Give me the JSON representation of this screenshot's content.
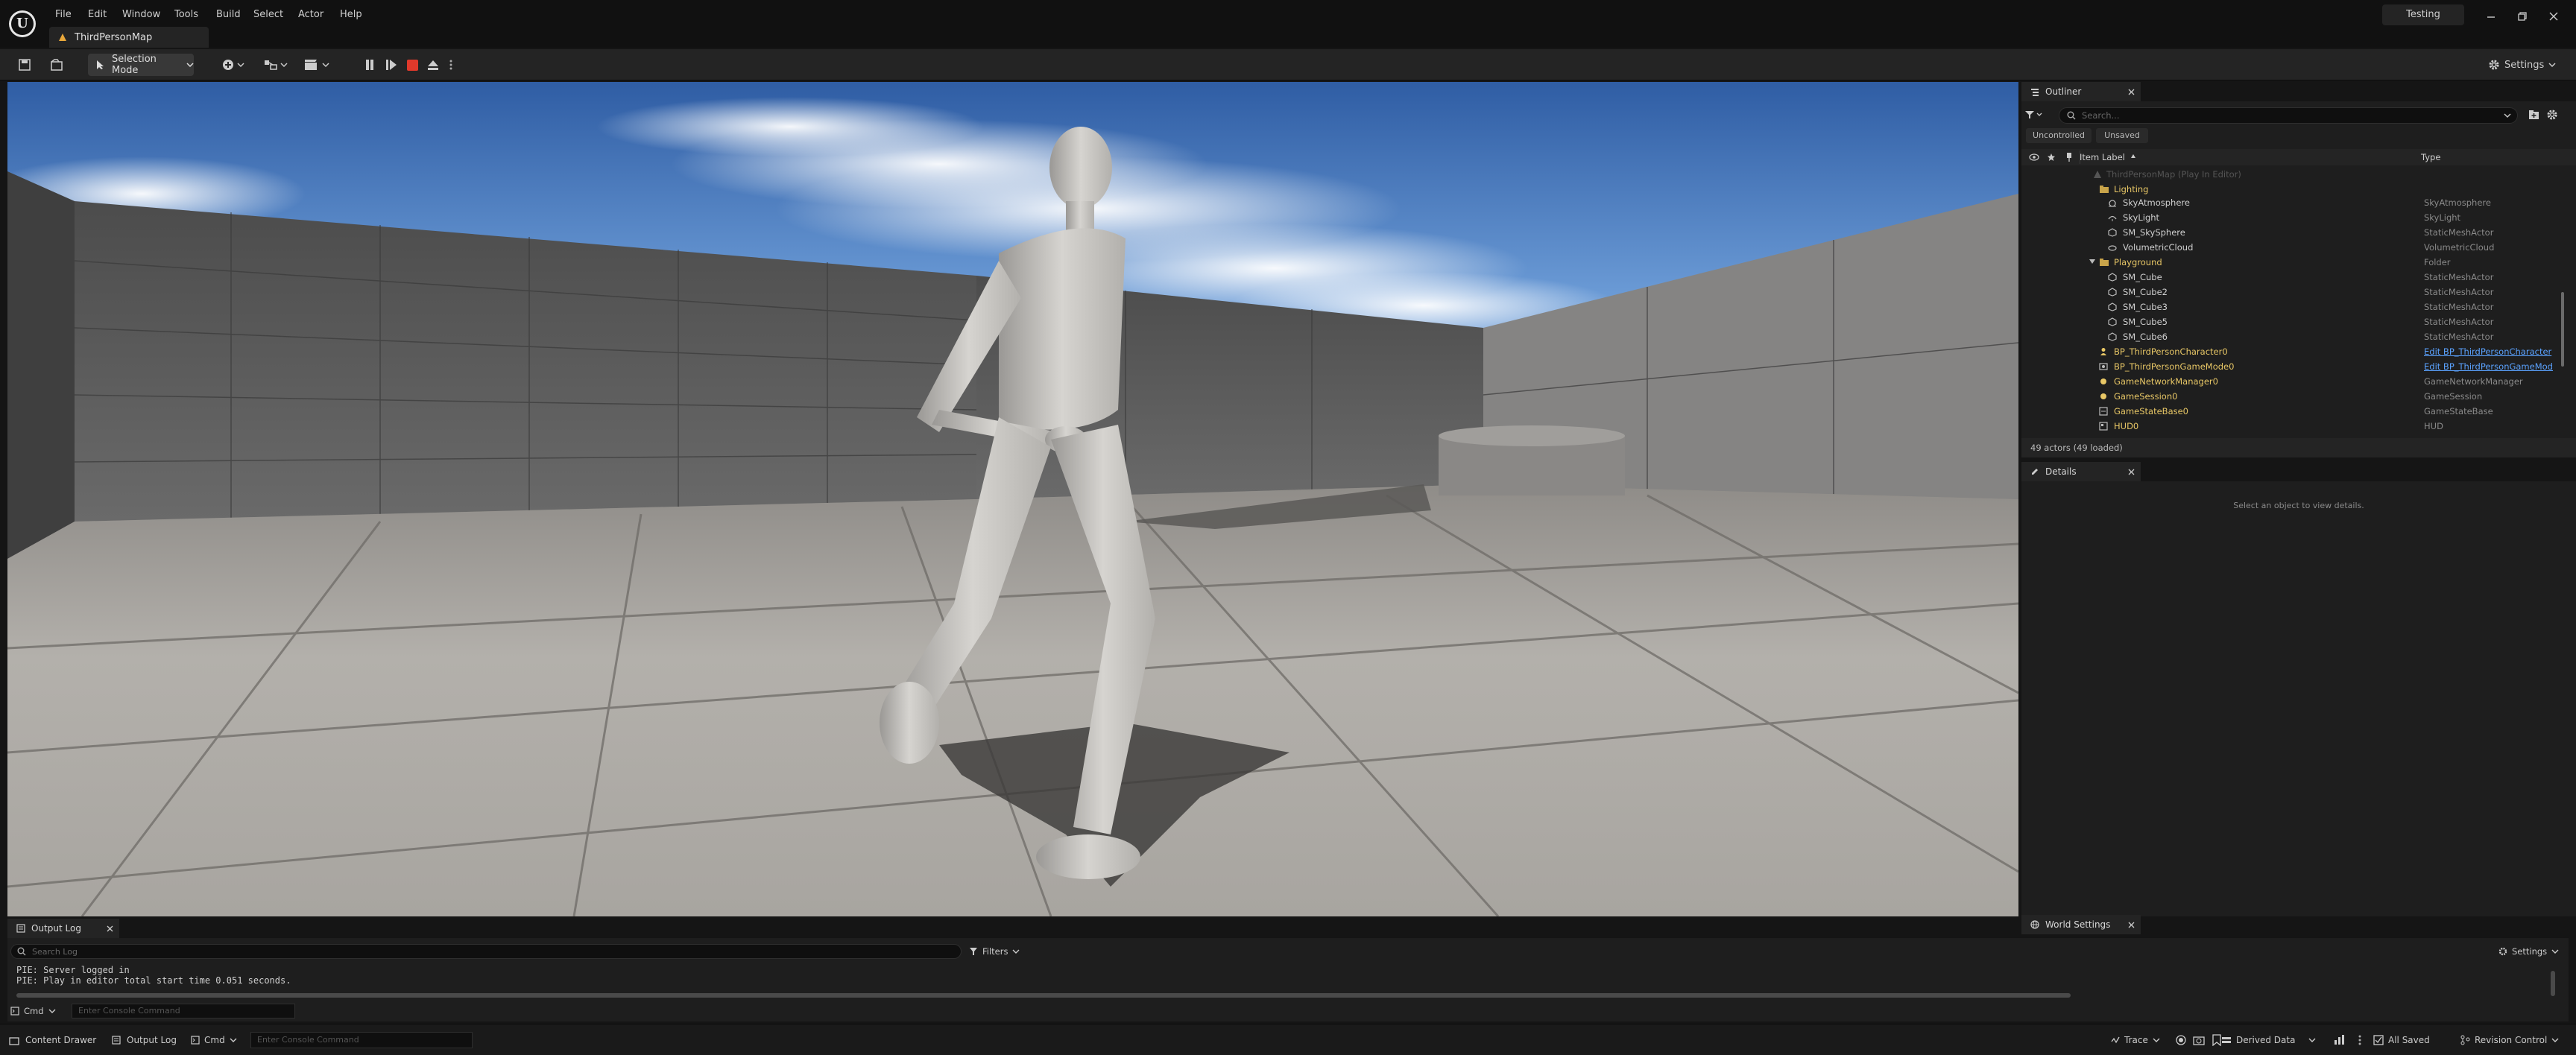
{
  "titlebar": {
    "menus": [
      "File",
      "Edit",
      "Window",
      "Tools",
      "Build",
      "Select",
      "Actor",
      "Help"
    ],
    "map_tab": "ThirdPersonMap",
    "project_name": "Testing"
  },
  "toolbar": {
    "selection_mode": "Selection Mode",
    "settings": "Settings"
  },
  "outliner": {
    "tab": "Outliner",
    "search_placeholder": "Search...",
    "filters": [
      "Uncontrolled",
      "Unsaved"
    ],
    "col_label": "Item Label",
    "col_type": "Type",
    "root": "ThirdPersonMap (Play In Editor)",
    "rows": [
      {
        "label": "Lighting",
        "type": ""
      },
      {
        "label": "SkyAtmosphere",
        "type": "SkyAtmosphere"
      },
      {
        "label": "SkyLight",
        "type": "SkyLight"
      },
      {
        "label": "SM_SkySphere",
        "type": "StaticMeshActor"
      },
      {
        "label": "VolumetricCloud",
        "type": "VolumetricCloud"
      },
      {
        "label": "Playground",
        "type": "Folder"
      },
      {
        "label": "SM_Cube",
        "type": "StaticMeshActor"
      },
      {
        "label": "SM_Cube2",
        "type": "StaticMeshActor"
      },
      {
        "label": "SM_Cube3",
        "type": "StaticMeshActor"
      },
      {
        "label": "SM_Cube5",
        "type": "StaticMeshActor"
      },
      {
        "label": "SM_Cube6",
        "type": "StaticMeshActor"
      },
      {
        "label": "BP_ThirdPersonCharacter0",
        "type": "Edit BP_ThirdPersonCharacter"
      },
      {
        "label": "BP_ThirdPersonGameMode0",
        "type": "Edit BP_ThirdPersonGameMod"
      },
      {
        "label": "GameNetworkManager0",
        "type": "GameNetworkManager"
      },
      {
        "label": "GameSession0",
        "type": "GameSession"
      },
      {
        "label": "GameStateBase0",
        "type": "GameStateBase"
      },
      {
        "label": "HUD0",
        "type": "HUD"
      }
    ],
    "status": "49 actors (49 loaded)"
  },
  "details": {
    "tab": "Details",
    "empty_text": "Select an object to view details."
  },
  "world_settings": {
    "tab": "World Settings"
  },
  "output_log": {
    "tab": "Output Log",
    "search_placeholder": "Search Log",
    "filters_label": "Filters",
    "settings_label": "Settings",
    "lines": [
      "PIE: Server logged in",
      "PIE: Play in editor total start time 0.051 seconds."
    ],
    "cmd_label": "Cmd",
    "console_placeholder": "Enter Console Command"
  },
  "bottombar": {
    "content_drawer": "Content Drawer",
    "output_log": "Output Log",
    "cmd": "Cmd",
    "console_placeholder": "Enter Console Command",
    "trace": "Trace",
    "derived_data": "Derived Data",
    "all_saved": "All Saved",
    "revision_control": "Revision Control"
  },
  "colors": {
    "accent": "#e8c766",
    "play_stop": "#e0392b",
    "link": "#5aa2ff"
  }
}
